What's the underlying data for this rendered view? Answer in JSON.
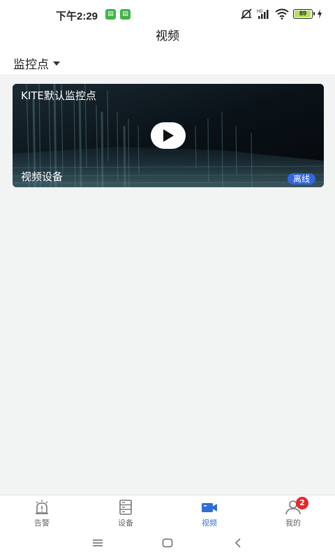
{
  "status_bar": {
    "time": "下午2:29",
    "battery": "89",
    "notification_icons": [
      "app-notification-icon",
      "app-notification-icon"
    ],
    "accent_color": "#3fb44a"
  },
  "header": {
    "title": "视频"
  },
  "filter": {
    "label": "监控点"
  },
  "video_card": {
    "title": "KITE默认监控点",
    "device_name": "视频设备",
    "status": "离线",
    "status_color": "#3366e0"
  },
  "tabs": [
    {
      "label": "告警",
      "icon": "alarm-icon",
      "active": false
    },
    {
      "label": "设备",
      "icon": "device-server-icon",
      "active": false
    },
    {
      "label": "视频",
      "icon": "video-camera-icon",
      "active": true
    },
    {
      "label": "我的",
      "icon": "user-icon",
      "active": false,
      "badge": "2"
    }
  ],
  "colors": {
    "active_tab": "#2f6fd6",
    "badge": "#e8282b",
    "background": "#f2f3f3"
  }
}
